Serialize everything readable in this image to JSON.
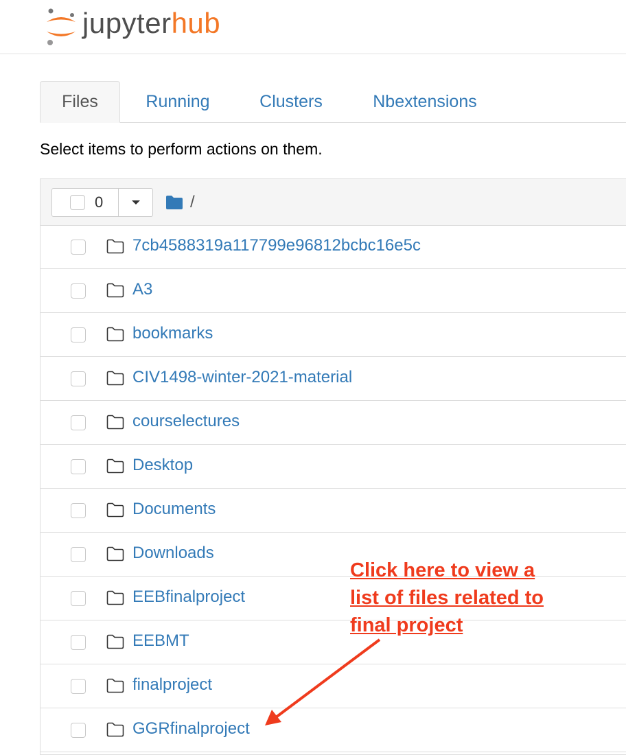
{
  "header": {
    "logo_prefix": "jupyter",
    "logo_suffix": "hub"
  },
  "tabs": [
    {
      "label": "Files",
      "active": true
    },
    {
      "label": "Running",
      "active": false
    },
    {
      "label": "Clusters",
      "active": false
    },
    {
      "label": "Nbextensions",
      "active": false
    }
  ],
  "hint_text": "Select items to perform actions on them.",
  "list_header": {
    "selected_count": "0",
    "breadcrumb": "/"
  },
  "files": [
    {
      "name": "7cb4588319a117799e96812bcbc16e5c",
      "type": "folder"
    },
    {
      "name": "A3",
      "type": "folder"
    },
    {
      "name": "bookmarks",
      "type": "folder"
    },
    {
      "name": "CIV1498-winter-2021-material",
      "type": "folder"
    },
    {
      "name": "courselectures",
      "type": "folder"
    },
    {
      "name": "Desktop",
      "type": "folder"
    },
    {
      "name": "Documents",
      "type": "folder"
    },
    {
      "name": "Downloads",
      "type": "folder"
    },
    {
      "name": "EEBfinalproject",
      "type": "folder"
    },
    {
      "name": "EEBMT",
      "type": "folder"
    },
    {
      "name": "finalproject",
      "type": "folder"
    },
    {
      "name": "GGRfinalproject",
      "type": "folder"
    }
  ],
  "annotation": {
    "lines": [
      "Click here to view a",
      "list of files related to",
      "final project"
    ],
    "color": "#ef3b1d"
  },
  "colors": {
    "link": "#337ab7",
    "brand_orange": "#f37726"
  }
}
